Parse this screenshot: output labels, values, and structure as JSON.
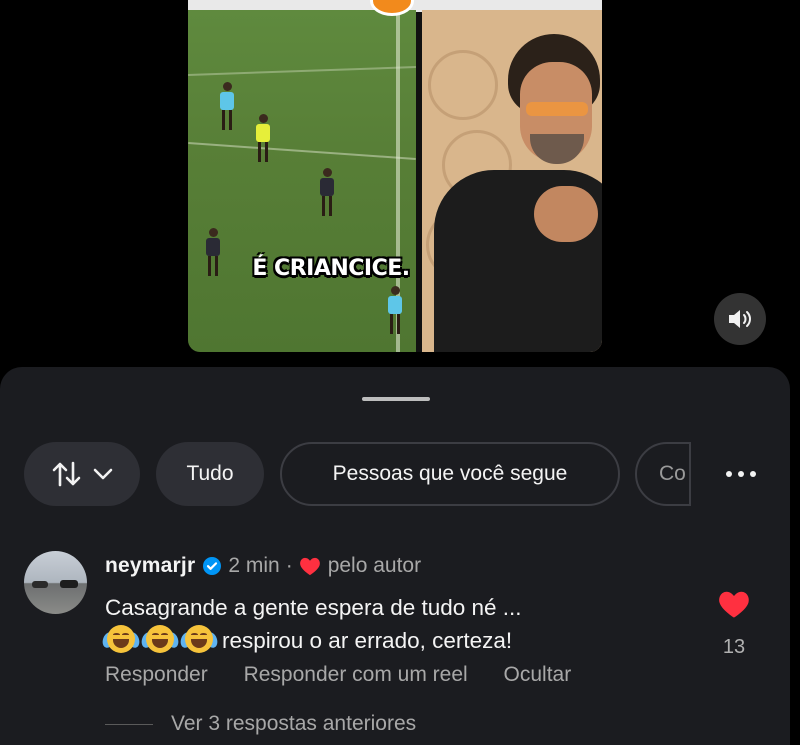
{
  "video": {
    "caption": "É CRIANCICE."
  },
  "filters": {
    "sort_icon": "sort-arrows-icon",
    "all_label": "Tudo",
    "following_label": "Pessoas que você segue",
    "partial_label": "Co"
  },
  "comment": {
    "username": "neymarjr",
    "time": "2 min",
    "separator": "·",
    "liked_by": "pelo autor",
    "text_line1": "Casagrande a gente espera de tudo né ...",
    "text_line2": "respirou o ar errado, certeza!",
    "emoji_count": 3,
    "likes": "13",
    "actions": {
      "reply": "Responder",
      "reply_reel": "Responder com um reel",
      "hide": "Ocultar"
    },
    "view_replies": "Ver 3 respostas anteriores"
  },
  "colors": {
    "sheet_bg": "#1b1c20",
    "heart_red": "#ff3040",
    "verified_blue": "#0095f6"
  }
}
